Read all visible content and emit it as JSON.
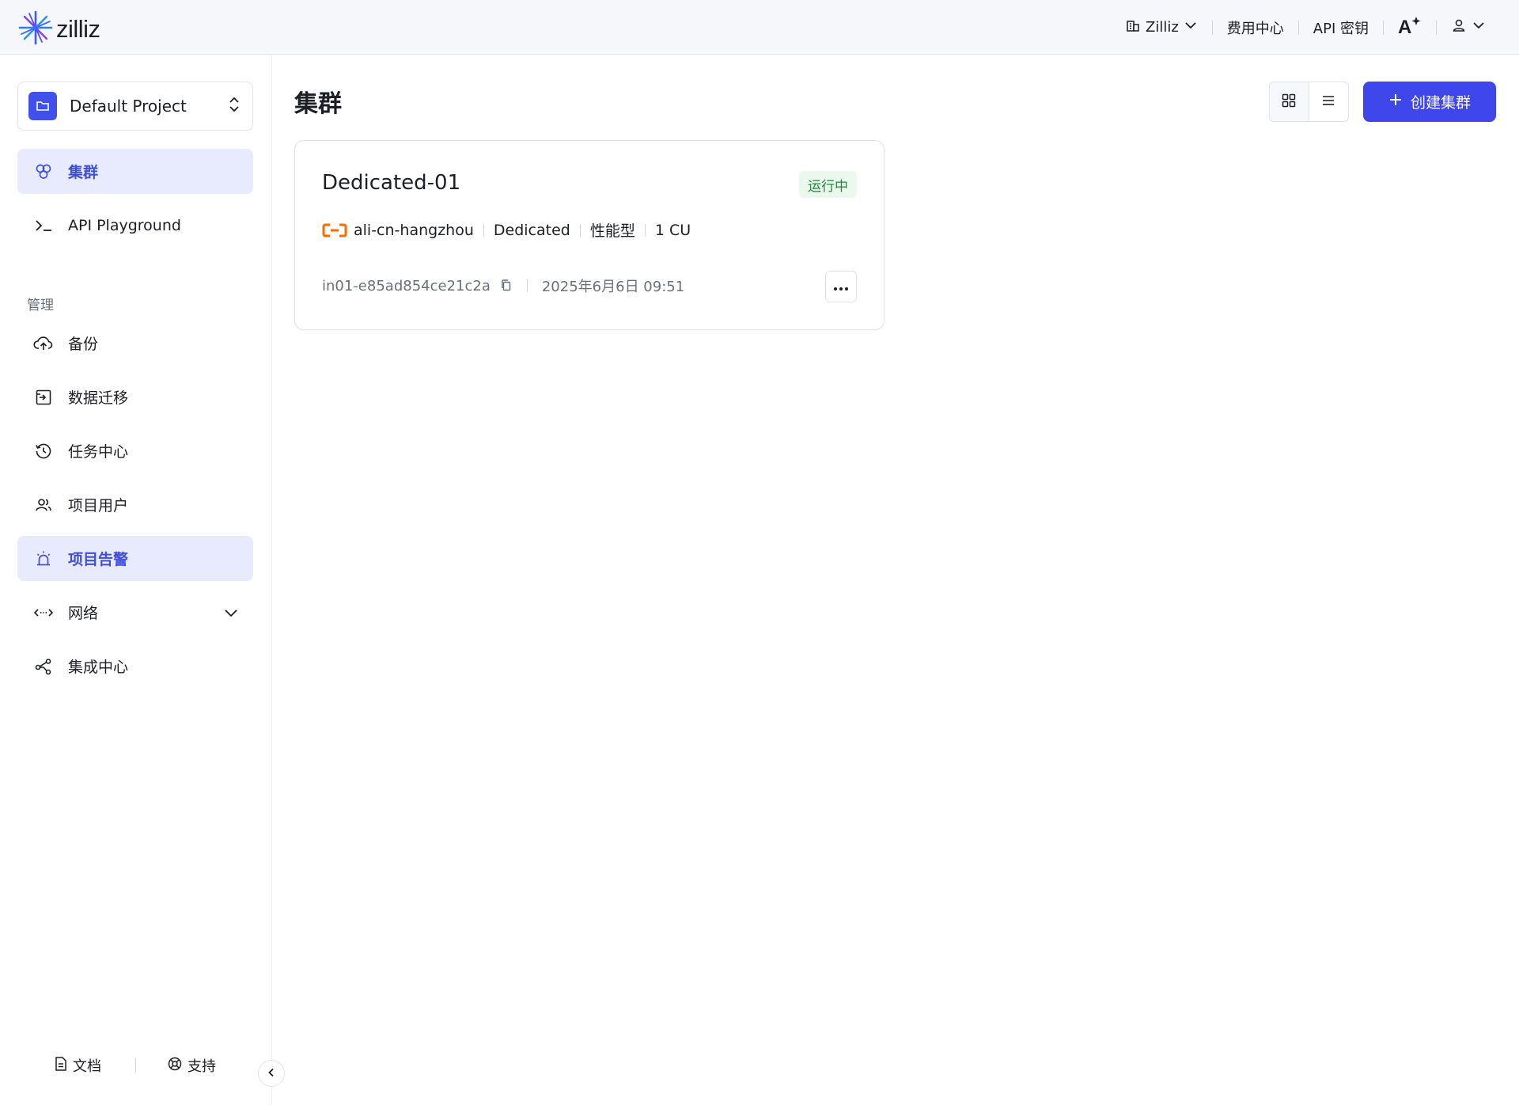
{
  "header": {
    "logo_text": "zilliz",
    "org_label": "Zilliz",
    "billing_label": "费用中心",
    "api_key_label": "API 密钥"
  },
  "sidebar": {
    "project_name": "Default Project",
    "items": [
      {
        "label": "集群",
        "icon": "clusters-icon",
        "active": true
      },
      {
        "label": "API Playground",
        "icon": "terminal-icon"
      }
    ],
    "section_label": "管理",
    "manage_items": [
      {
        "label": "备份",
        "icon": "cloud-upload-icon"
      },
      {
        "label": "数据迁移",
        "icon": "migration-icon"
      },
      {
        "label": "任务中心",
        "icon": "history-icon"
      },
      {
        "label": "项目用户",
        "icon": "users-icon"
      },
      {
        "label": "项目告警",
        "icon": "alarm-icon",
        "active": true
      },
      {
        "label": "网络",
        "icon": "network-icon",
        "expandable": true
      },
      {
        "label": "集成中心",
        "icon": "integration-icon"
      }
    ],
    "footer": {
      "docs_label": "文档",
      "support_label": "支持"
    }
  },
  "main": {
    "title": "集群",
    "create_button_label": "创建集群",
    "cluster_card": {
      "name": "Dedicated-01",
      "status": "运行中",
      "region": "ali-cn-hangzhou",
      "plan": "Dedicated",
      "cu_type": "性能型",
      "cu_size": "1 CU",
      "instance_id": "in01-e85ad854ce21c2a",
      "created_at": "2025年6月6日 09:51"
    }
  },
  "colors": {
    "accent": "#3f46ec",
    "active_bg": "#e8eafd",
    "status_green": "#21883a",
    "aliyun_orange": "#ff6a00"
  }
}
